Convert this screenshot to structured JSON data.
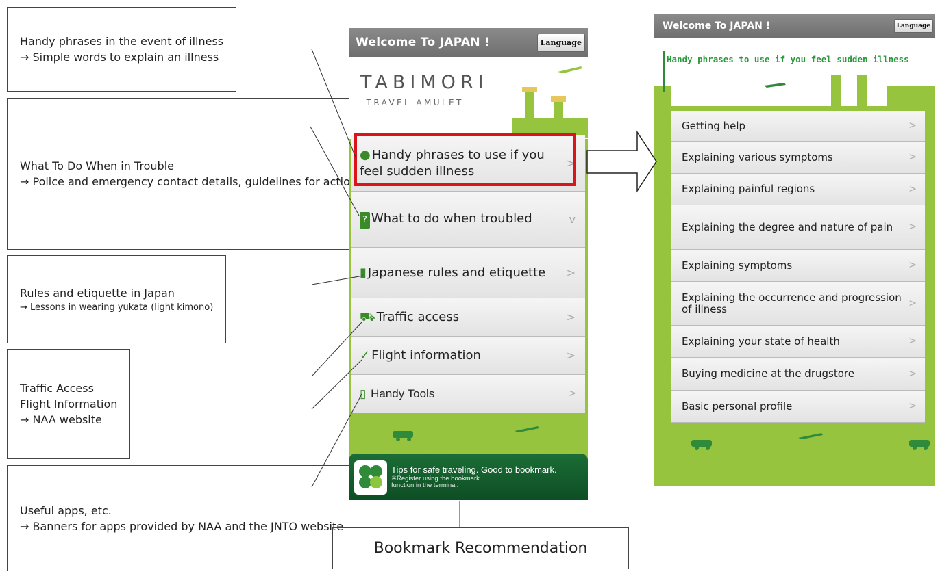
{
  "callouts": [
    {
      "heading": "Handy phrases in the event of illness",
      "detail": "→ Simple words to explain an illness"
    },
    {
      "heading": "What To Do When in Trouble",
      "detail": "→ Police and emergency contact details, guidelines for action in the event of an earthquake"
    },
    {
      "heading": "Rules and etiquette in Japan",
      "detail": "→ Lessons in wearing yukata (light kimono)"
    },
    {
      "heading": "Traffic Access",
      "detail": "Flight Information",
      "detail2": "→ NAA website"
    },
    {
      "heading": "Useful apps, etc.",
      "detail": "→ Banners for apps provided by NAA and the JNTO website"
    }
  ],
  "bookmark_label": "Bookmark Recommendation",
  "phone1": {
    "title": "Welcome To JAPAN !",
    "language_label": "Language",
    "brand": "TABIMORI",
    "tagline": "-TRAVEL AMULET-",
    "menu": [
      {
        "label": "Handy phrases to use if you feel sudden illness",
        "icon": "speech-bubbles-icon",
        "chevron": ">"
      },
      {
        "label": "What to do when troubled",
        "icon": "question-icon",
        "chevron": "v"
      },
      {
        "label": "Japanese rules and etiquette",
        "icon": "book-icon",
        "chevron": ">"
      },
      {
        "label": "Traffic access",
        "icon": "bus-icon",
        "chevron": ">"
      },
      {
        "label": "Flight information",
        "icon": "plane-icon",
        "chevron": ">"
      },
      {
        "label": "Handy Tools",
        "icon": "phone-icon",
        "chevron": ">"
      }
    ],
    "banner": {
      "main": "Tips for safe traveling. Good to bookmark.",
      "sub": "※Register using the bookmark function in the terminal."
    }
  },
  "phone2": {
    "title": "Welcome To JAPAN !",
    "language_label": "Language",
    "header": "Handy phrases to use if you feel sudden illness",
    "menu": [
      "Getting help",
      "Explaining various symptoms",
      "Explaining painful regions",
      "Explaining the degree and nature of pain",
      "Explaining symptoms",
      "Explaining the occurrence and progression of illness",
      "Explaining your state of health",
      "Buying medicine at the drugstore",
      "Basic personal profile"
    ],
    "chevron": ">"
  }
}
